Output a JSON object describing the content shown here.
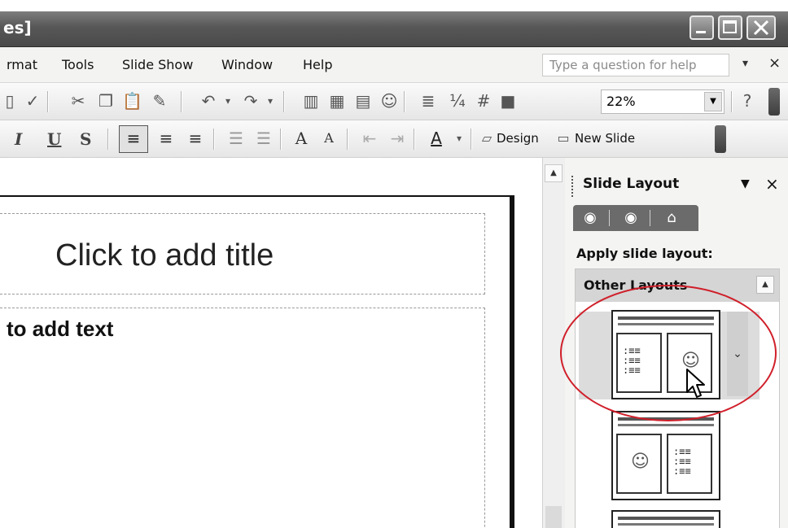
{
  "window": {
    "title": "es]"
  },
  "menu": {
    "items": [
      {
        "label": "rmat"
      },
      {
        "label": "Tools"
      },
      {
        "label": "Slide Show"
      },
      {
        "label": "Window"
      },
      {
        "label": "Help"
      }
    ],
    "help_placeholder": "Type a question for help"
  },
  "toolbar": {
    "zoom_value": "22%",
    "design_label": "Design",
    "new_slide_label": "New Slide",
    "format_buttons": [
      "I",
      "U",
      "S"
    ]
  },
  "slide": {
    "title_placeholder": "Click to add title",
    "body_placeholder": "to add text"
  },
  "task_pane": {
    "title": "Slide Layout",
    "apply_label": "Apply slide layout:",
    "section_label": "Other Layouts",
    "layouts": [
      {
        "name": "title-text-and-content",
        "selected": true
      },
      {
        "name": "title-content-and-text",
        "selected": false
      },
      {
        "name": "title-and-content",
        "selected": false
      }
    ]
  },
  "annotation_color": "#d01f2a"
}
